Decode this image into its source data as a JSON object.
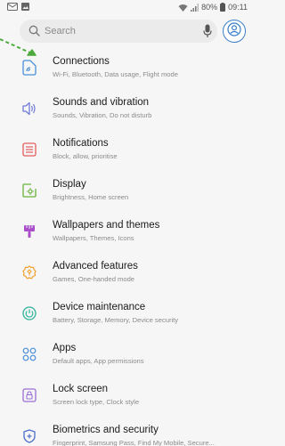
{
  "status_bar": {
    "battery_percent": "80%",
    "time": "09:11",
    "icons": [
      "notification-icon",
      "gallery-icon",
      "wifi-icon",
      "signal-icon",
      "battery-icon"
    ]
  },
  "search": {
    "placeholder": "Search",
    "icons": [
      "search-icon",
      "mic-icon",
      "account-icon"
    ]
  },
  "settings": {
    "items": [
      {
        "title": "Connections",
        "subtitle": "Wi-Fi, Bluetooth, Data usage, Flight mode",
        "icon": "connections-icon",
        "color": "#4a8fd8"
      },
      {
        "title": "Sounds and vibration",
        "subtitle": "Sounds, Vibration, Do not disturb",
        "icon": "volume-icon",
        "color": "#6f7bd8"
      },
      {
        "title": "Notifications",
        "subtitle": "Block, allow, prioritise",
        "icon": "notifications-icon",
        "color": "#e35d5d"
      },
      {
        "title": "Display",
        "subtitle": "Brightness, Home screen",
        "icon": "display-icon",
        "color": "#69b23a"
      },
      {
        "title": "Wallpapers and themes",
        "subtitle": "Wallpapers, Themes, Icons",
        "icon": "paint-brush-icon",
        "color": "#a94fc9"
      },
      {
        "title": "Advanced features",
        "subtitle": "Games, One-handed mode",
        "icon": "advanced-features-icon",
        "color": "#f0a12c"
      },
      {
        "title": "Device maintenance",
        "subtitle": "Battery, Storage, Memory, Device security",
        "icon": "device-maintenance-icon",
        "color": "#2fb39a"
      },
      {
        "title": "Apps",
        "subtitle": "Default apps, App permissions",
        "icon": "apps-icon",
        "color": "#4a8fd8"
      },
      {
        "title": "Lock screen",
        "subtitle": "Screen lock type, Clock style",
        "icon": "lock-icon",
        "color": "#9b6fd6"
      },
      {
        "title": "Biometrics and security",
        "subtitle": "Fingerprint, Samsung Pass, Find My Mobile, Secure...",
        "icon": "shield-icon",
        "color": "#4e6fc8"
      }
    ]
  },
  "annotation": {
    "color": "#4caa3c"
  }
}
